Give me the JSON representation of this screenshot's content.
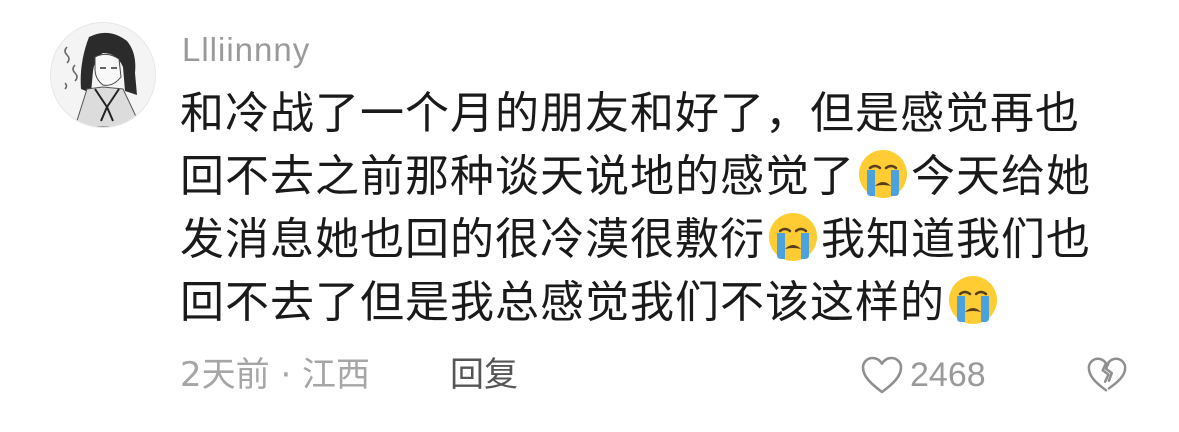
{
  "comment": {
    "username": "Llliinnny",
    "avatar_icon": "anime-girl-avatar",
    "lines": [
      [
        "和冷战了一个月的朋友和好了，但是感觉再也"
      ],
      [
        "回不去之前那种谈天说地的感觉了",
        "emoji:crying-face",
        "今天给她"
      ],
      [
        "发消息她也回的很冷漠很敷衍",
        "emoji:crying-face",
        "我知道我们也"
      ],
      [
        "回不去了但是我总感觉我们不该这样的",
        "emoji:crying-face"
      ]
    ],
    "line_1": "和冷战了一个月的朋友和好了，但是感觉再也",
    "line_2a": "回不去之前那种谈天说地的感觉了",
    "line_2b": "今天给她",
    "line_3a": "发消息她也回的很冷漠很敷衍",
    "line_3b": "我知道我们也",
    "line_4a": "回不去了但是我总感觉我们不该这样的",
    "emoji_icon": "loudly-crying-face-icon",
    "time_location": "2天前 · 江西",
    "reply_label": "回复",
    "like_count": "2468",
    "like_icon": "heart-outline-icon",
    "dislike_icon": "broken-heart-outline-icon"
  },
  "colors": {
    "text": "#1a1a1a",
    "muted": "#9a9a9a",
    "reply": "#555555",
    "emoji_face": "#ffcc33",
    "emoji_tears": "#4aa3df"
  }
}
